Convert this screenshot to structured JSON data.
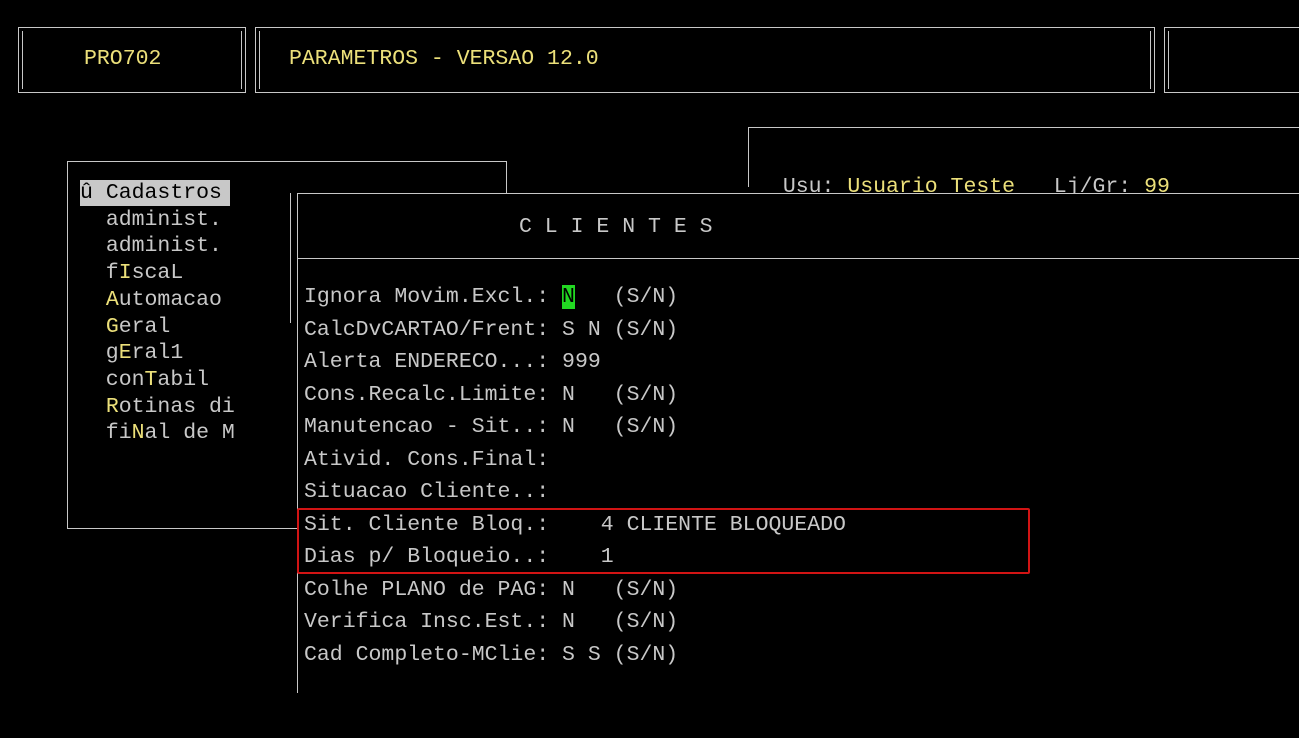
{
  "header": {
    "program_code": "PRO702",
    "title": "PARAMETROS - VERSAO 12.0"
  },
  "user_bar": {
    "user_label": "Usu:",
    "user_name": "Usuario Teste",
    "store_label": "Lj/Gr:",
    "store_value": "99"
  },
  "menu": {
    "items": [
      {
        "prefix": "û ",
        "hot": "",
        "rest": "Cadastros",
        "selected": true
      },
      {
        "prefix": "  ",
        "hot": "",
        "rest": "administ."
      },
      {
        "prefix": "  ",
        "hot": "",
        "rest": "administ."
      },
      {
        "prefix": "  f",
        "hot": "I",
        "rest": "scaL"
      },
      {
        "prefix": "  ",
        "hot": "A",
        "rest": "utomacao"
      },
      {
        "prefix": "  ",
        "hot": "G",
        "rest": "eral"
      },
      {
        "prefix": "  g",
        "hot": "E",
        "rest": "ral1"
      },
      {
        "prefix": "  con",
        "hot": "T",
        "rest": "abil"
      },
      {
        "prefix": "  ",
        "hot": "R",
        "rest": "otinas di"
      },
      {
        "prefix": "  fi",
        "hot": "N",
        "rest": "al de M"
      }
    ]
  },
  "panel": {
    "title": "C L I E N T E S",
    "rows": [
      {
        "label": "Ignora Movim.Excl.:",
        "value": "N",
        "hint": "(S/N)",
        "cursor": true
      },
      {
        "label": "CalcDvCARTAO/Frent:",
        "value": "S N",
        "hint": "(S/N)"
      },
      {
        "label": "Alerta ENDERECO...:",
        "value": "999",
        "hint": ""
      },
      {
        "label": "Cons.Recalc.Limite:",
        "value": "N",
        "hint": "(S/N)"
      },
      {
        "label": "Manutencao - Sit..:",
        "value": "N",
        "hint": "(S/N)"
      },
      {
        "label": "Ativid. Cons.Final:",
        "value": "",
        "hint": ""
      },
      {
        "label": "Situacao Cliente..:",
        "value": "",
        "hint": ""
      },
      {
        "label": "Sit. Cliente Bloq.:",
        "value": "   4",
        "hint": "CLIENTE BLOQUEADO"
      },
      {
        "label": "Dias p/ Bloqueio..:",
        "value": "   1",
        "hint": ""
      },
      {
        "label": "Colhe PLANO de PAG:",
        "value": "N",
        "hint": "(S/N)"
      },
      {
        "label": "Verifica Insc.Est.:",
        "value": "N",
        "hint": "(S/N)"
      },
      {
        "label": "Cad Completo-MClie:",
        "value": "S S",
        "hint": "(S/N)"
      }
    ]
  }
}
